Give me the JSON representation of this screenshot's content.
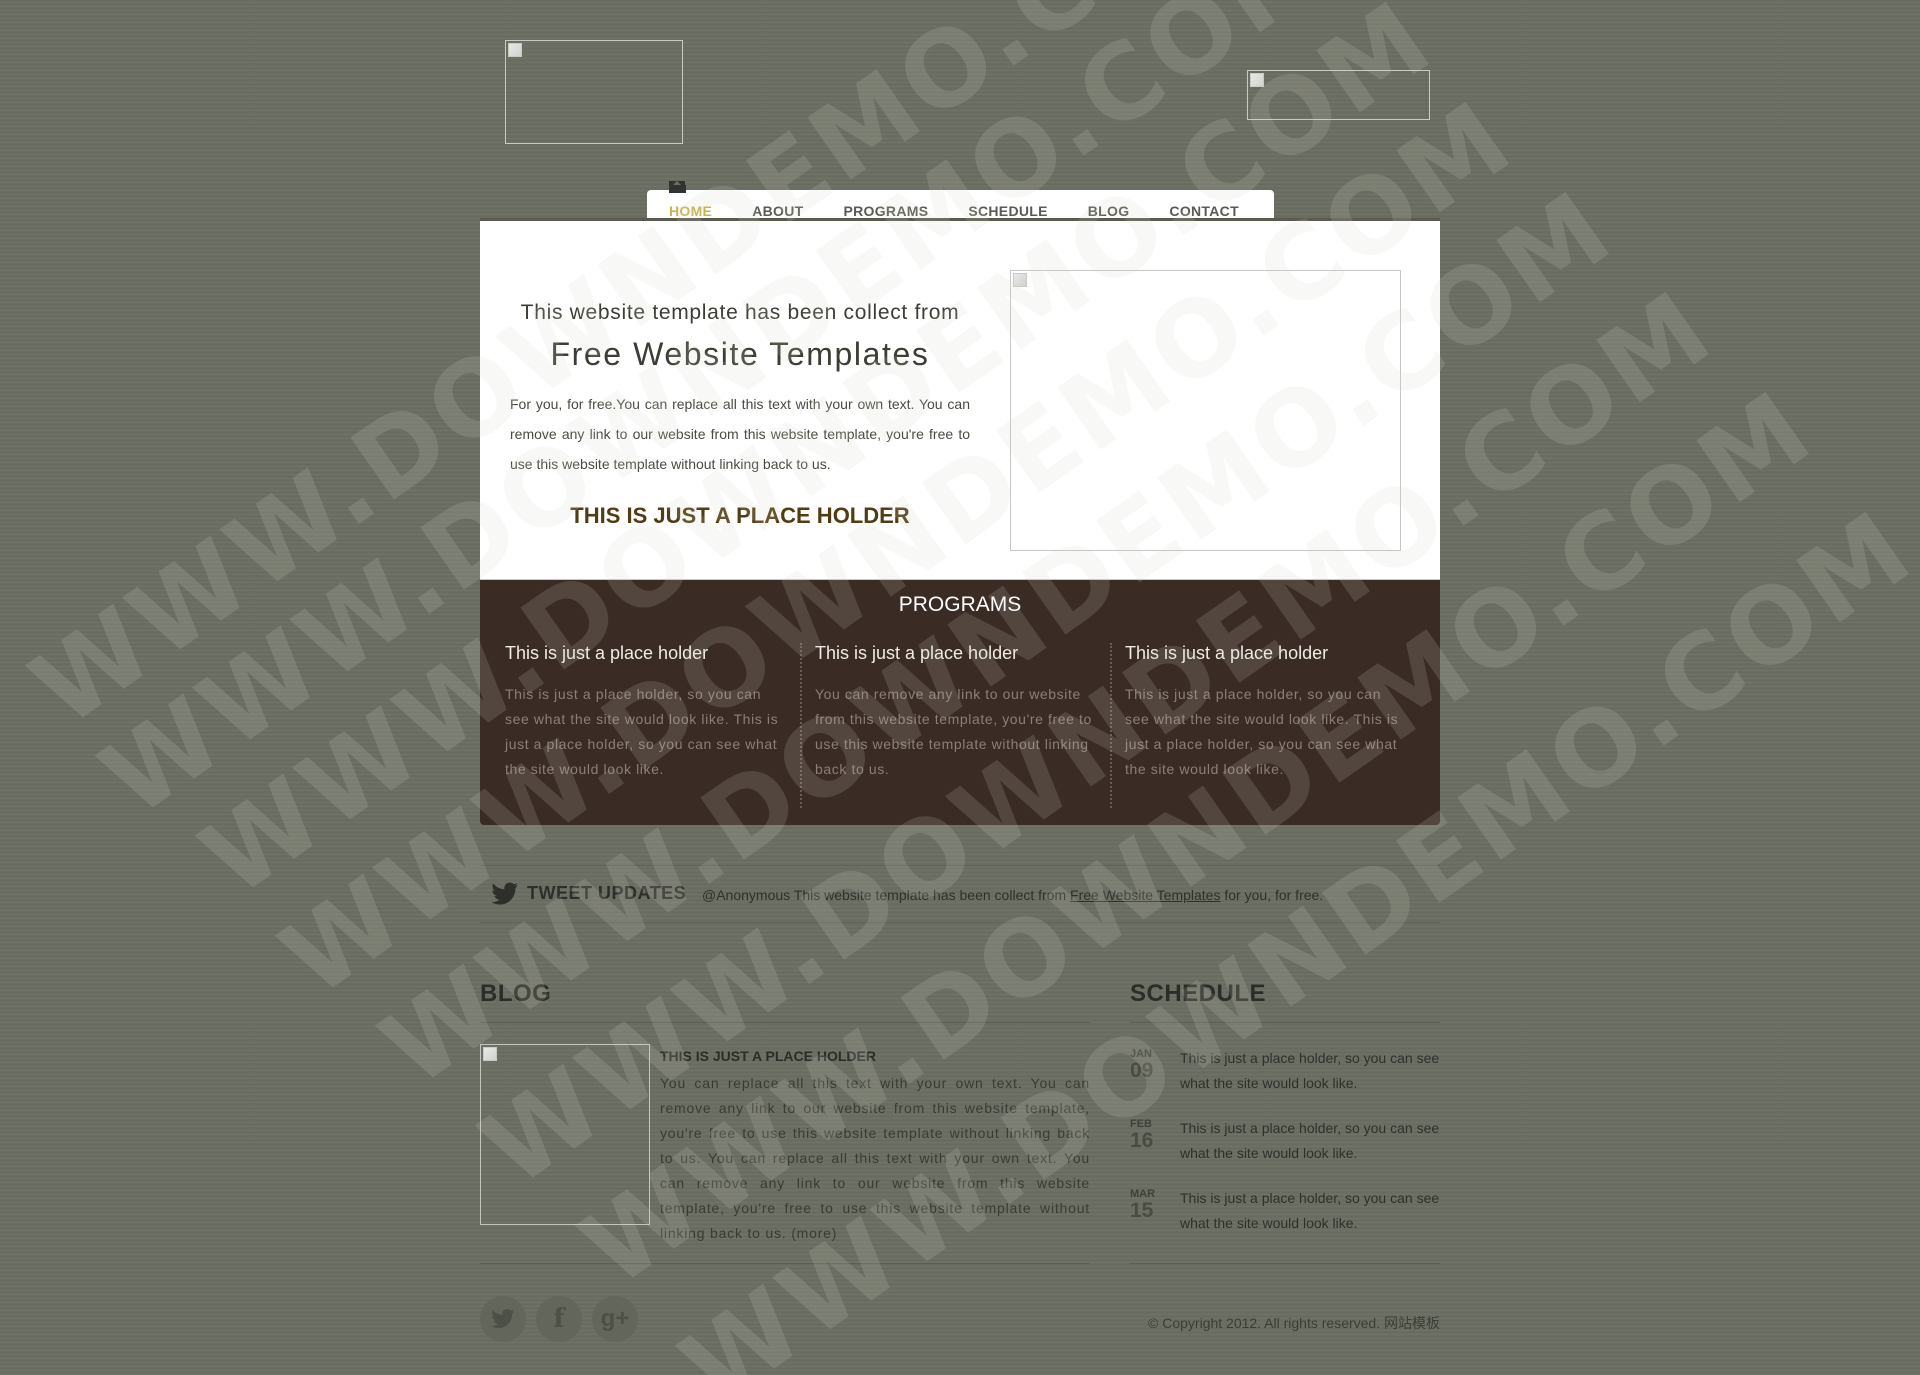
{
  "header": {
    "logo_alt": "",
    "right_image_alt": ""
  },
  "nav": {
    "items": [
      "HOME",
      "ABOUT",
      "PROGRAMS",
      "SCHEDULE",
      "BLOG",
      "CONTACT"
    ],
    "active": "HOME"
  },
  "featured": {
    "subtitle": "This website template has been collect from",
    "title": "Free Website Templates",
    "text": "For you, for free.You can replace all this text with your own text. You can remove any link to our website from this website template, you're free to use this website template without linking back to us.",
    "cta": "THIS IS JUST A PLACE HOLDER"
  },
  "programs": {
    "title": "PROGRAMS",
    "items": [
      {
        "title": "This is just a place holder",
        "text": "This is just a place holder, so you can see what the site would look like. This is just a place holder, so you can see what the site would look like."
      },
      {
        "title": "This is just a place holder",
        "text": "You can remove any link to our website from this website template, you're free to use this website template without linking back to us."
      },
      {
        "title": "This is just a place holder",
        "text": "This is just a place holder, so you can see what the site would look like. This is just a place holder, so you can see what the site would look like."
      }
    ]
  },
  "tweet": {
    "label": "TWEET UPDATES",
    "prefix": "@Anonymous This website template has been collect from ",
    "link": "Free Website Templates",
    "suffix": " for you, for free."
  },
  "blog": {
    "title": "BLOG",
    "post_title": "THIS IS JUST A PLACE HOLDER",
    "post_text": "You can replace all this text with your own text. You can remove any link to our website from this website template, you're free to use this website template without linking back to us. You can replace all this text with your own text. You can remove any link to our website from this website template, you're free to use this website template without linking back to us.",
    "more": "(more)"
  },
  "schedule": {
    "title": "SCHEDULE",
    "items": [
      {
        "month": "JAN",
        "day": "09",
        "text": "This is just a place holder, so you can see what the site would look like."
      },
      {
        "month": "FEB",
        "day": "16",
        "text": "This is just a place holder, so you can see what the site would look like."
      },
      {
        "month": "MAR",
        "day": "15",
        "text": "This is just a place holder, so you can see what the site would look like."
      }
    ]
  },
  "footer": {
    "social": [
      "twitter-icon",
      "facebook-icon",
      "google-plus-icon"
    ],
    "copyright": "© Copyright 2012. All rights reserved. 网站模板"
  },
  "watermark": "WWW.DOWNDEMO.COM",
  "colors": {
    "background": "#6b6f63",
    "programs_bg": "#3b2b25",
    "nav_active": "#c9b44a",
    "cta": "#523c13"
  }
}
